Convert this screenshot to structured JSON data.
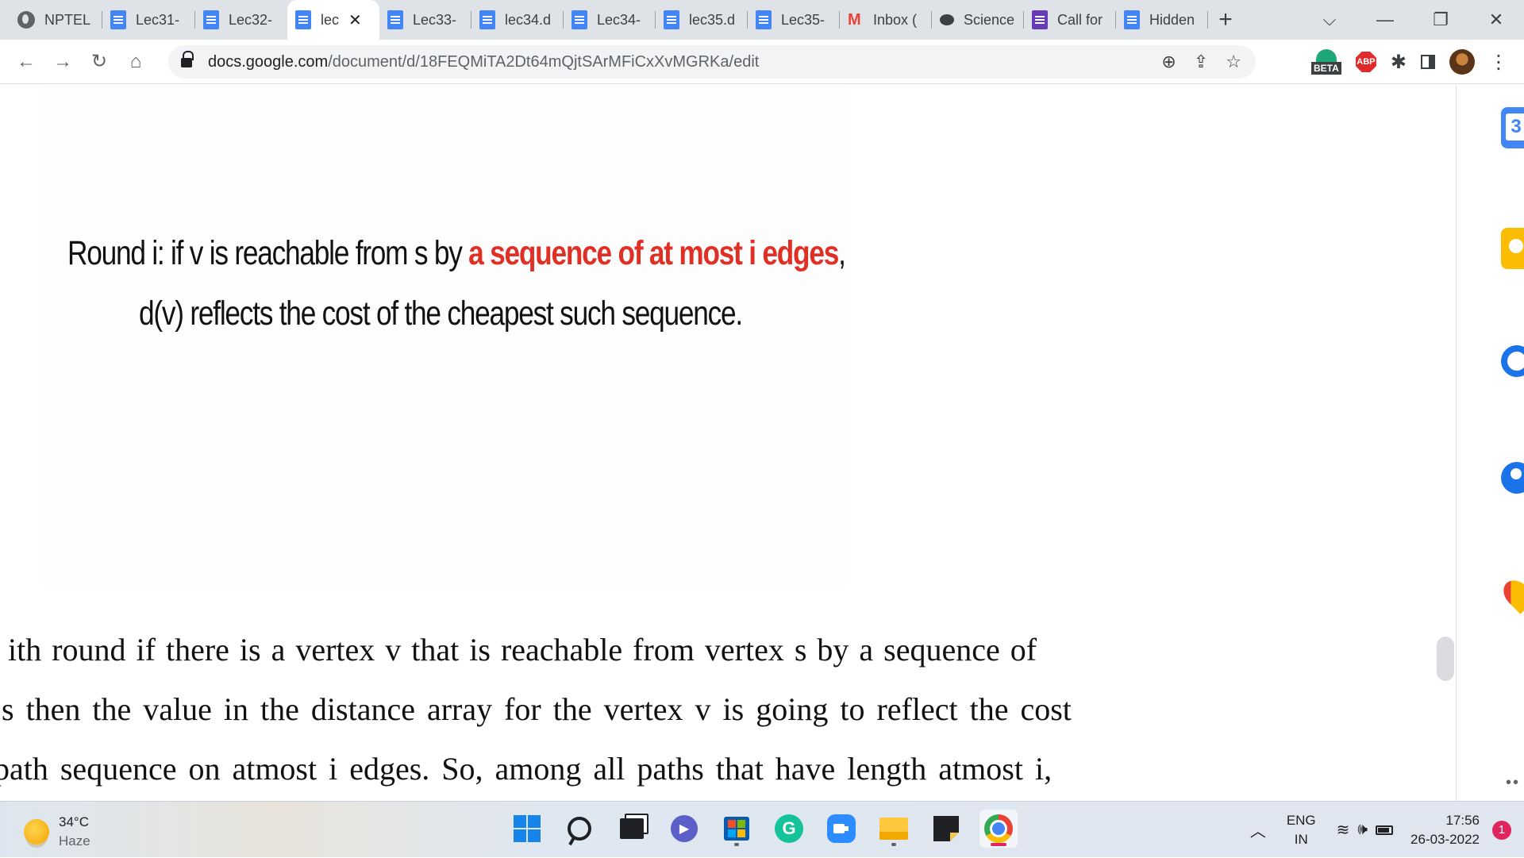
{
  "browser": {
    "tabs": [
      {
        "label": "NPTEL",
        "icon": "globe-icon"
      },
      {
        "label": "Lec31-",
        "icon": "docs-icon"
      },
      {
        "label": "Lec32-",
        "icon": "docs-icon"
      },
      {
        "label": "lec",
        "icon": "docs-icon",
        "active": true
      },
      {
        "label": "Lec33-",
        "icon": "docs-icon"
      },
      {
        "label": "lec34.d",
        "icon": "docs-icon"
      },
      {
        "label": "Lec34-",
        "icon": "docs-icon"
      },
      {
        "label": "lec35.d",
        "icon": "docs-icon"
      },
      {
        "label": "Lec35-",
        "icon": "docs-icon"
      },
      {
        "label": "Inbox (",
        "icon": "gmail-icon"
      },
      {
        "label": "Science",
        "icon": "chat-icon"
      },
      {
        "label": "Call for",
        "icon": "forms-icon"
      },
      {
        "label": "Hidden",
        "icon": "docs-icon"
      }
    ],
    "new_tab": "+",
    "close_tab": "✕",
    "url_host": "docs.google.com",
    "url_path": "/document/d/18FEQMiTA2Dt64mQjtSArMFiCxXvMGRKa/edit",
    "extension_beta_label": "BETA",
    "extension_abp_label": "ABP"
  },
  "document": {
    "slide": {
      "line1_prefix": "Round i: if v is reachable from s by ",
      "line1_highlight": "a sequence of at most i edges",
      "line1_suffix": ",",
      "line2": "d(v) reflects the cost of the cheapest such sequence.",
      "highlight_color": "#e03026"
    },
    "body_lines": [
      "ith round if there is a vertex v that is reachable from vertex s by a sequence of",
      "s then the value in the distance array for the vertex v is going to reflect the cost",
      "path sequence on atmost i edges. So, among all paths that have length atmost i,"
    ]
  },
  "taskbar": {
    "temperature": "34°C",
    "weather": "Haze",
    "language_top": "ENG",
    "language_bottom": "IN",
    "time": "17:56",
    "date": "26-03-2022",
    "notification_count": "1"
  }
}
